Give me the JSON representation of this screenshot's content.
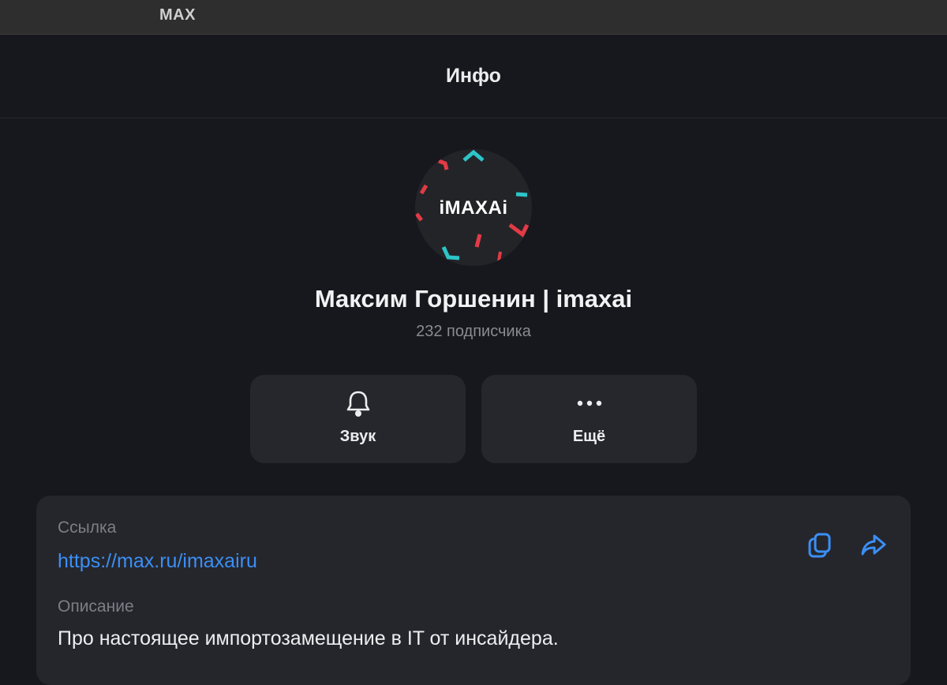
{
  "app": {
    "title": "MAX"
  },
  "header": {
    "title": "Инфо"
  },
  "channel": {
    "avatar_text": "iMAXAi",
    "name": "Максим Горшенин | imaxai",
    "subscribers": "232 подписчика"
  },
  "actions": [
    {
      "label": "Звук",
      "icon": "bell-icon"
    },
    {
      "label": "Ещё",
      "icon": "more-horizontal-icon"
    }
  ],
  "info": {
    "link_label": "Ссылка",
    "link_value": "https://max.ru/imaxairu",
    "description_label": "Описание",
    "description_value": "Про настоящее импортозамещение в IT от инсайдера.",
    "copy_icon": "copy-icon",
    "share_icon": "share-icon"
  },
  "colors": {
    "background": "#17181d",
    "card": "#25262c",
    "accent": "#3b8ff5",
    "logo_teal": "#2ec4c7",
    "logo_red": "#e23b46"
  }
}
